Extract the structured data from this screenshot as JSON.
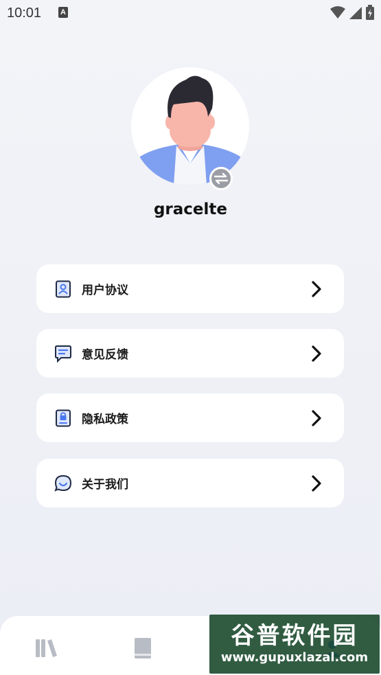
{
  "status_bar": {
    "time": "10:01",
    "notification_icon_letter": "A",
    "icons": [
      "wifi-icon",
      "signal-icon",
      "battery-icon"
    ]
  },
  "profile": {
    "username": "gracelte",
    "avatar_icon": "avatar-illustration",
    "switch_icon": "swap-arrows-icon"
  },
  "menu": [
    {
      "label": "用户协议",
      "icon": "user-document-icon"
    },
    {
      "label": "意见反馈",
      "icon": "message-icon"
    },
    {
      "label": "隐私政策",
      "icon": "lock-document-icon"
    },
    {
      "label": "关于我们",
      "icon": "chat-bubble-icon"
    }
  ],
  "bottom_nav": {
    "items": [
      {
        "icon": "library-books-icon"
      },
      {
        "icon": "book-icon"
      },
      {
        "icon": "profile-icon"
      }
    ]
  },
  "watermark": {
    "title": "谷普软件园",
    "url": "www.gupuxlazal.com"
  },
  "colors": {
    "accent": "#4a78f0",
    "background": "#f0f2f7",
    "card": "#ffffff",
    "icon_gray": "#b8bcc4"
  }
}
